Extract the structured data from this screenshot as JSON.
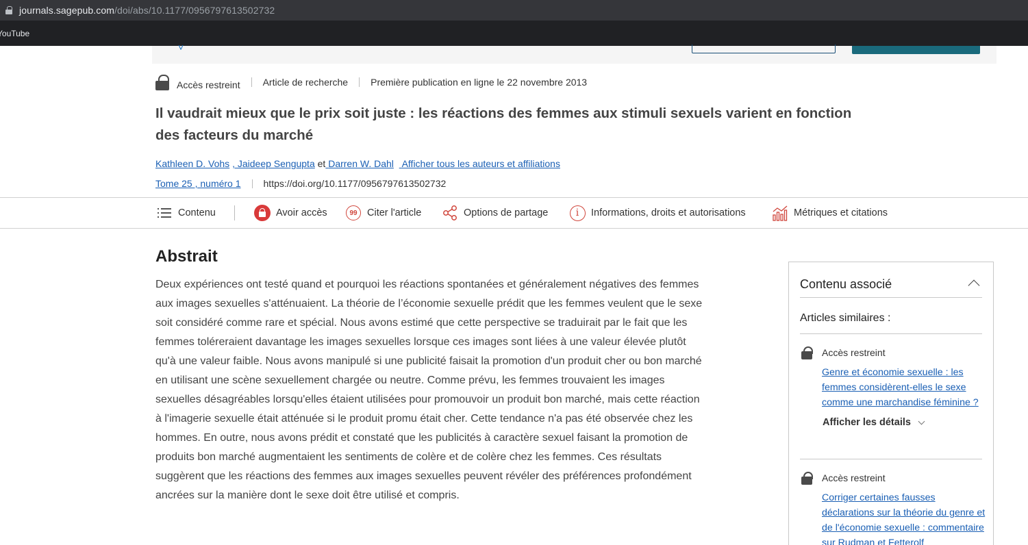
{
  "browser": {
    "url_host": "journals.sagepub.com",
    "url_path": "/doi/abs/10.1177/0956797613502732",
    "bookmark": "YouTube"
  },
  "meta": {
    "access": "Accès restreint",
    "type": "Article de recherche",
    "published": "Première publication en ligne le 22 novembre 2013"
  },
  "article": {
    "title": "Il vaudrait mieux que le prix soit juste : les réactions des femmes aux stimuli sexuels varient en fonction des facteurs du marché",
    "authors": [
      "Kathleen D. Vohs",
      ", Jaideep Sengupta",
      "Darren W. Dahl"
    ],
    "authors_and": "et",
    "all_authors_link": "Afficher tous les auteurs et affiliations",
    "issue": "Tome 25 , numéro 1",
    "doi": "https://doi.org/10.1177/0956797613502732"
  },
  "toolbar": {
    "contents": "Contenu",
    "access": "Avoir accès",
    "cite": "Citer l'article",
    "share": "Options de partage",
    "info": "Informations, droits et autorisations",
    "metrics": "Métriques et citations",
    "cite_glyph": "99",
    "info_glyph": "i"
  },
  "abstract": {
    "heading": "Abstrait",
    "text": "Deux expériences ont testé quand et pourquoi les réactions spontanées et généralement négatives des femmes aux images sexuelles s'atténuaient. La théorie de l’économie sexuelle prédit que les femmes veulent que le sexe soit considéré comme rare et spécial. Nous avons estimé que cette perspective se traduirait par le fait que les femmes toléreraient davantage les images sexuelles lorsque ces images sont liées à une valeur élevée plutôt qu'à une valeur faible. Nous avons manipulé si une publicité faisait la promotion d'un produit cher ou bon marché en utilisant une scène sexuellement chargée ou neutre. Comme prévu, les femmes trouvaient les images sexuelles désagréables lorsqu'elles étaient utilisées pour promouvoir un produit bon marché, mais cette réaction à l'imagerie sexuelle était atténuée si le produit promu était cher. Cette tendance n'a pas été observée chez les hommes. En outre, nous avons prédit et constaté que les publicités à caractère sexuel faisant la promotion de produits bon marché augmentaient les sentiments de colère et de colère chez les femmes. Ces résultats suggèrent que les réactions des femmes aux images sexuelles peuvent révéler des préférences profondément ancrées sur la manière dont le sexe doit être utilisé et compris."
  },
  "sidebar": {
    "heading": "Contenu associé",
    "similar": "Articles similaires :",
    "items": [
      {
        "access": "Accès restreint",
        "title": "Genre et économie sexuelle : les femmes considèrent-elles le sexe comme une marchandise féminine ?",
        "details": "Afficher les détails"
      },
      {
        "access": "Accès restreint",
        "title": "Corriger certaines fausses déclarations sur la théorie du genre et de l'économie sexuelle : commentaire sur Rudman et Fetterolf"
      }
    ]
  },
  "colors": {
    "link": "#1a5fb4",
    "accent_red": "#d93a3a",
    "teal": "#1a6a7c"
  }
}
